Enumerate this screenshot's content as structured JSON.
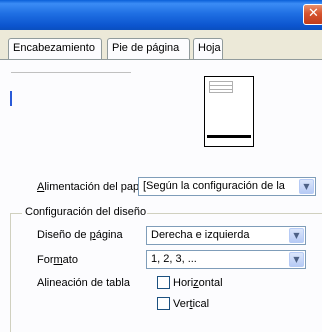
{
  "window": {
    "close_glyph": "✕"
  },
  "tabs": [
    {
      "label": "Encabezamiento"
    },
    {
      "label": "Pie de página"
    },
    {
      "label": "Hoja"
    }
  ],
  "alimentacion": {
    "label_prefix": "A",
    "label_rest": "limentación del pap",
    "value": "[Según la configuración de la"
  },
  "layout_group": {
    "title": "Configuración del diseño",
    "page_layout": {
      "label_prefix": "Diseño de ",
      "label_accel": "p",
      "label_rest": "ágina",
      "value": "Derecha e izquierda"
    },
    "format": {
      "label_prefix": "For",
      "label_accel": "m",
      "label_rest": "ato",
      "value": "1, 2, 3, ..."
    },
    "table_alignment": {
      "label": "Alineación de tabla",
      "horizontal": {
        "label_prefix": "Hori",
        "label_accel": "z",
        "label_rest": "ontal",
        "checked": false
      },
      "vertical": {
        "label_prefix": "Ver",
        "label_accel": "t",
        "label_rest": "ical",
        "checked": false
      }
    }
  },
  "icons": {
    "combo_arrow": "▼"
  },
  "colors": {
    "titlebar": "#0c55cf",
    "close": "#d6532e",
    "panel": "#fcfcfe",
    "dialog_bg": "#ece9d8"
  }
}
